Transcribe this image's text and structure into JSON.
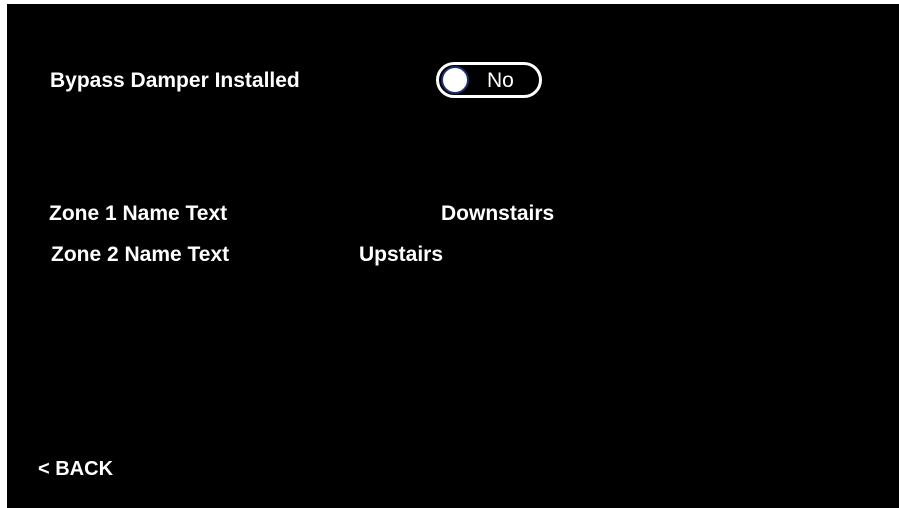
{
  "settings": {
    "bypass_damper_label": "Bypass Damper Installed",
    "bypass_damper_value": "No",
    "bypass_damper_enabled": false
  },
  "zones": [
    {
      "label": "Zone 1 Name Text",
      "value": "Downstairs"
    },
    {
      "label": "Zone 2 Name Text",
      "value": "Upstairs"
    }
  ],
  "nav": {
    "back_label": "< BACK"
  },
  "colors": {
    "background": "#000000",
    "text": "#ffffff",
    "toggle_knob_border": "#1d2f6b"
  }
}
